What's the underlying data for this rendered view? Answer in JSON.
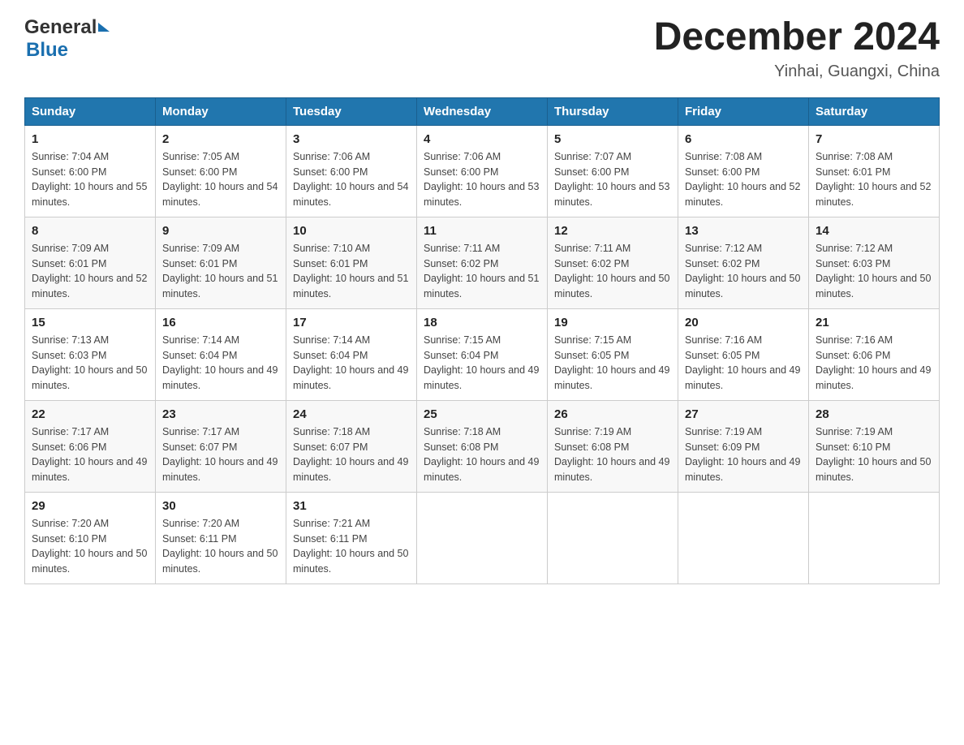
{
  "header": {
    "logo_general": "General",
    "logo_blue": "Blue",
    "month_title": "December 2024",
    "location": "Yinhai, Guangxi, China"
  },
  "days_of_week": [
    "Sunday",
    "Monday",
    "Tuesday",
    "Wednesday",
    "Thursday",
    "Friday",
    "Saturday"
  ],
  "weeks": [
    [
      {
        "day": "1",
        "sunrise": "7:04 AM",
        "sunset": "6:00 PM",
        "daylight": "10 hours and 55 minutes."
      },
      {
        "day": "2",
        "sunrise": "7:05 AM",
        "sunset": "6:00 PM",
        "daylight": "10 hours and 54 minutes."
      },
      {
        "day": "3",
        "sunrise": "7:06 AM",
        "sunset": "6:00 PM",
        "daylight": "10 hours and 54 minutes."
      },
      {
        "day": "4",
        "sunrise": "7:06 AM",
        "sunset": "6:00 PM",
        "daylight": "10 hours and 53 minutes."
      },
      {
        "day": "5",
        "sunrise": "7:07 AM",
        "sunset": "6:00 PM",
        "daylight": "10 hours and 53 minutes."
      },
      {
        "day": "6",
        "sunrise": "7:08 AM",
        "sunset": "6:00 PM",
        "daylight": "10 hours and 52 minutes."
      },
      {
        "day": "7",
        "sunrise": "7:08 AM",
        "sunset": "6:01 PM",
        "daylight": "10 hours and 52 minutes."
      }
    ],
    [
      {
        "day": "8",
        "sunrise": "7:09 AM",
        "sunset": "6:01 PM",
        "daylight": "10 hours and 52 minutes."
      },
      {
        "day": "9",
        "sunrise": "7:09 AM",
        "sunset": "6:01 PM",
        "daylight": "10 hours and 51 minutes."
      },
      {
        "day": "10",
        "sunrise": "7:10 AM",
        "sunset": "6:01 PM",
        "daylight": "10 hours and 51 minutes."
      },
      {
        "day": "11",
        "sunrise": "7:11 AM",
        "sunset": "6:02 PM",
        "daylight": "10 hours and 51 minutes."
      },
      {
        "day": "12",
        "sunrise": "7:11 AM",
        "sunset": "6:02 PM",
        "daylight": "10 hours and 50 minutes."
      },
      {
        "day": "13",
        "sunrise": "7:12 AM",
        "sunset": "6:02 PM",
        "daylight": "10 hours and 50 minutes."
      },
      {
        "day": "14",
        "sunrise": "7:12 AM",
        "sunset": "6:03 PM",
        "daylight": "10 hours and 50 minutes."
      }
    ],
    [
      {
        "day": "15",
        "sunrise": "7:13 AM",
        "sunset": "6:03 PM",
        "daylight": "10 hours and 50 minutes."
      },
      {
        "day": "16",
        "sunrise": "7:14 AM",
        "sunset": "6:04 PM",
        "daylight": "10 hours and 49 minutes."
      },
      {
        "day": "17",
        "sunrise": "7:14 AM",
        "sunset": "6:04 PM",
        "daylight": "10 hours and 49 minutes."
      },
      {
        "day": "18",
        "sunrise": "7:15 AM",
        "sunset": "6:04 PM",
        "daylight": "10 hours and 49 minutes."
      },
      {
        "day": "19",
        "sunrise": "7:15 AM",
        "sunset": "6:05 PM",
        "daylight": "10 hours and 49 minutes."
      },
      {
        "day": "20",
        "sunrise": "7:16 AM",
        "sunset": "6:05 PM",
        "daylight": "10 hours and 49 minutes."
      },
      {
        "day": "21",
        "sunrise": "7:16 AM",
        "sunset": "6:06 PM",
        "daylight": "10 hours and 49 minutes."
      }
    ],
    [
      {
        "day": "22",
        "sunrise": "7:17 AM",
        "sunset": "6:06 PM",
        "daylight": "10 hours and 49 minutes."
      },
      {
        "day": "23",
        "sunrise": "7:17 AM",
        "sunset": "6:07 PM",
        "daylight": "10 hours and 49 minutes."
      },
      {
        "day": "24",
        "sunrise": "7:18 AM",
        "sunset": "6:07 PM",
        "daylight": "10 hours and 49 minutes."
      },
      {
        "day": "25",
        "sunrise": "7:18 AM",
        "sunset": "6:08 PM",
        "daylight": "10 hours and 49 minutes."
      },
      {
        "day": "26",
        "sunrise": "7:19 AM",
        "sunset": "6:08 PM",
        "daylight": "10 hours and 49 minutes."
      },
      {
        "day": "27",
        "sunrise": "7:19 AM",
        "sunset": "6:09 PM",
        "daylight": "10 hours and 49 minutes."
      },
      {
        "day": "28",
        "sunrise": "7:19 AM",
        "sunset": "6:10 PM",
        "daylight": "10 hours and 50 minutes."
      }
    ],
    [
      {
        "day": "29",
        "sunrise": "7:20 AM",
        "sunset": "6:10 PM",
        "daylight": "10 hours and 50 minutes."
      },
      {
        "day": "30",
        "sunrise": "7:20 AM",
        "sunset": "6:11 PM",
        "daylight": "10 hours and 50 minutes."
      },
      {
        "day": "31",
        "sunrise": "7:21 AM",
        "sunset": "6:11 PM",
        "daylight": "10 hours and 50 minutes."
      },
      null,
      null,
      null,
      null
    ]
  ]
}
